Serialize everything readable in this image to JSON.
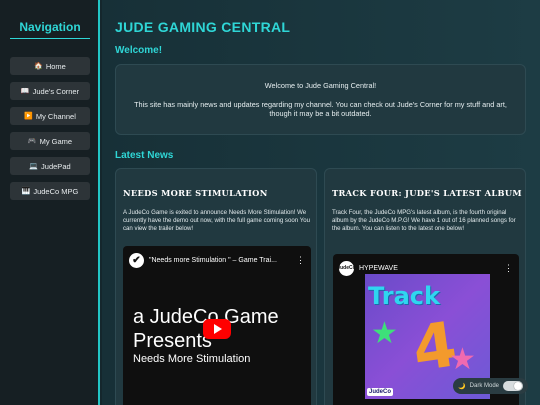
{
  "sidebar": {
    "title": "Navigation",
    "items": [
      {
        "icon": "🏠",
        "label": "Home"
      },
      {
        "icon": "📖",
        "label": "Jude's Corner"
      },
      {
        "icon": "▶️",
        "label": "My Channel"
      },
      {
        "icon": "🎮",
        "label": "My Game"
      },
      {
        "icon": "💻",
        "label": "JudePad"
      },
      {
        "icon": "🎹",
        "label": "JudeCo MPG"
      }
    ]
  },
  "header": {
    "title": "JUDE GAMING CENTRAL"
  },
  "welcome": {
    "heading": "Welcome!",
    "line1": "Welcome to Jude Gaming Central!",
    "line2": "This site has mainly news and updates regarding my channel. You can check out Jude's Corner for my stuff and art, though it may be a bit outdated."
  },
  "news": {
    "heading": "Latest News",
    "cards": [
      {
        "title": "NEEDS MORE STIMULATION",
        "text": "A JudeCo Game is exited to announce Needs More Stimulation! We currently have the demo out now, with the full game coming soon You can view the trailer below!",
        "video": {
          "title": "\"Needs more Stimulation \" – Game Trai...",
          "line1": "a JudeCo Game",
          "line2": "Presents",
          "line3": "Needs More Stimulation"
        }
      },
      {
        "title": "TRACK FOUR: JUDE'S LATEST ALBUM",
        "text": "Track Four, the JudeCo MPG's latest album, is the fourth original album by the JudeCo M.P.G! We have 1 out of 16 planned songs for the album. You can listen to the latest one below!",
        "video": {
          "title": "HYPEWAVE",
          "album_track": "Track",
          "album_number": "4",
          "album_brand": "JudeCo"
        }
      }
    ]
  },
  "dark_mode": {
    "label": "Dark Mode",
    "icon": "🌙"
  },
  "colors": {
    "accent": "#2fd6d6",
    "youtube_red": "#ff0000"
  }
}
